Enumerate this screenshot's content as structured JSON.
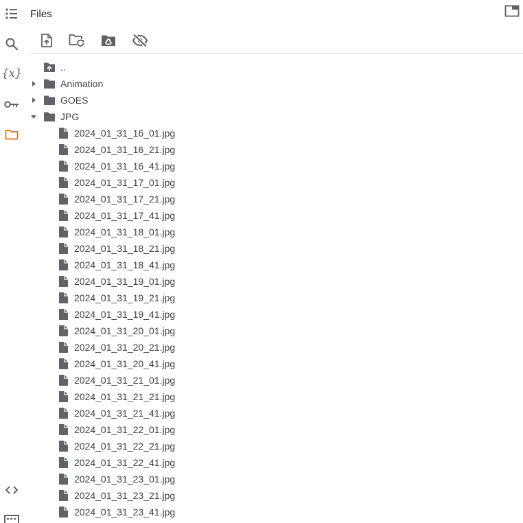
{
  "panel": {
    "title": "Files"
  },
  "rail": {
    "items": [
      {
        "name": "table-of-contents",
        "icon": "list-icon"
      },
      {
        "name": "search",
        "icon": "search-icon"
      },
      {
        "name": "variables",
        "icon": "variables-icon",
        "glyph": "{x}"
      },
      {
        "name": "secrets",
        "icon": "key-icon"
      },
      {
        "name": "files",
        "icon": "folder-icon",
        "active": true
      },
      {
        "name": "code-snippets",
        "icon": "code-icon"
      },
      {
        "name": "terminal",
        "icon": "terminal-icon"
      }
    ],
    "active_color": "#e8710a",
    "icon_color": "#5f6368"
  },
  "toolbar": {
    "buttons": [
      {
        "name": "upload-file",
        "icon": "upload-file-icon"
      },
      {
        "name": "refresh",
        "icon": "folder-refresh-icon"
      },
      {
        "name": "mount-drive",
        "icon": "drive-folder-icon"
      },
      {
        "name": "toggle-hidden",
        "icon": "eye-off-icon"
      }
    ]
  },
  "tree": {
    "parent_label": "..",
    "folders": [
      {
        "label": "Animation",
        "expanded": false
      },
      {
        "label": "GOES",
        "expanded": false
      },
      {
        "label": "JPG",
        "expanded": true
      }
    ],
    "files": [
      "2024_01_31_16_01.jpg",
      "2024_01_31_16_21.jpg",
      "2024_01_31_16_41.jpg",
      "2024_01_31_17_01.jpg",
      "2024_01_31_17_21.jpg",
      "2024_01_31_17_41.jpg",
      "2024_01_31_18_01.jpg",
      "2024_01_31_18_21.jpg",
      "2024_01_31_18_41.jpg",
      "2024_01_31_19_01.jpg",
      "2024_01_31_19_21.jpg",
      "2024_01_31_19_41.jpg",
      "2024_01_31_20_01.jpg",
      "2024_01_31_20_21.jpg",
      "2024_01_31_20_41.jpg",
      "2024_01_31_21_01.jpg",
      "2024_01_31_21_21.jpg",
      "2024_01_31_21_41.jpg",
      "2024_01_31_22_01.jpg",
      "2024_01_31_22_21.jpg",
      "2024_01_31_22_41.jpg",
      "2024_01_31_23_01.jpg",
      "2024_01_31_23_21.jpg",
      "2024_01_31_23_41.jpg"
    ]
  }
}
